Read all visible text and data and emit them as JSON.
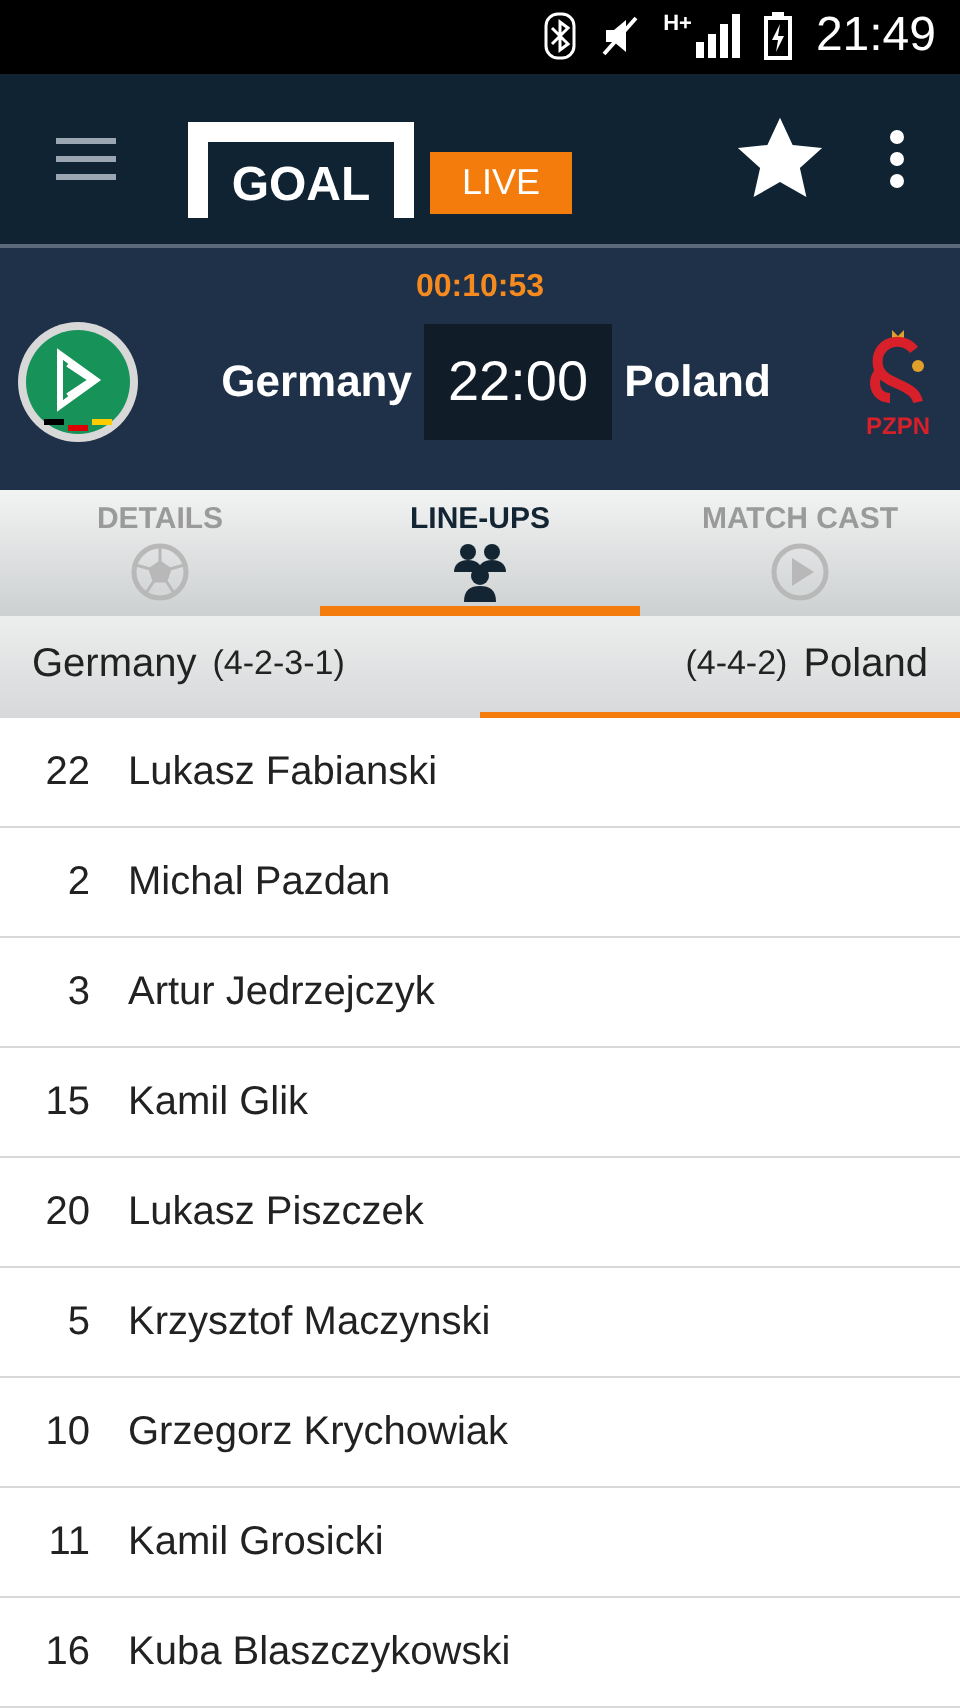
{
  "status_bar": {
    "time": "21:49",
    "network": "H+"
  },
  "app_bar": {
    "logo": "GOAL",
    "badge": "LIVE"
  },
  "match": {
    "elapsed": "00:10:53",
    "home": "Germany",
    "kickoff": "22:00",
    "away": "Poland",
    "away_crest_text": "PZPN"
  },
  "tabs": [
    {
      "label": "DETAILS",
      "kind": "ball",
      "selected": false
    },
    {
      "label": "LINE-UPS",
      "kind": "people",
      "selected": true
    },
    {
      "label": "MATCH CAST",
      "kind": "play",
      "selected": false
    }
  ],
  "teams": [
    {
      "name": "Germany",
      "formation": "(4-2-3-1)",
      "selected": false
    },
    {
      "name": "Poland",
      "formation": "(4-4-2)",
      "selected": true
    }
  ],
  "players": [
    {
      "number": "22",
      "name": "Lukasz Fabianski"
    },
    {
      "number": "2",
      "name": "Michal Pazdan"
    },
    {
      "number": "3",
      "name": "Artur Jedrzejczyk"
    },
    {
      "number": "15",
      "name": "Kamil Glik"
    },
    {
      "number": "20",
      "name": "Lukasz Piszczek"
    },
    {
      "number": "5",
      "name": "Krzysztof Maczynski"
    },
    {
      "number": "10",
      "name": "Grzegorz Krychowiak"
    },
    {
      "number": "11",
      "name": "Kamil Grosicki"
    },
    {
      "number": "16",
      "name": "Kuba Blaszczykowski"
    }
  ]
}
